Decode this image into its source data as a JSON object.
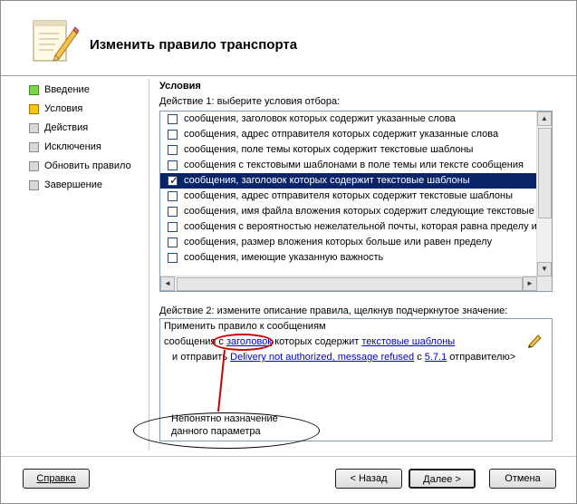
{
  "window": {
    "title": "Изменить правило транспорта"
  },
  "sidebar": {
    "items": [
      {
        "label": "Введение",
        "state": "done"
      },
      {
        "label": "Условия",
        "state": "current"
      },
      {
        "label": "Действия",
        "state": "pending"
      },
      {
        "label": "Исключения",
        "state": "pending"
      },
      {
        "label": "Обновить правило",
        "state": "pending"
      },
      {
        "label": "Завершение",
        "state": "pending"
      }
    ]
  },
  "conditions": {
    "section_title": "Условия",
    "step1_label": "Действие 1: выберите условия отбора:",
    "items": [
      {
        "label": "сообщения, заголовок которых содержит указанные слова",
        "checked": false
      },
      {
        "label": "сообщения, адрес отправителя которых содержит указанные слова",
        "checked": false
      },
      {
        "label": "сообщения, поле темы которых содержит текстовые шаблоны",
        "checked": false
      },
      {
        "label": "сообщения с текстовыми шаблонами в поле темы или тексте сообщения",
        "checked": false
      },
      {
        "label": "сообщения, заголовок которых содержит текстовые шаблоны",
        "checked": true,
        "selected": true
      },
      {
        "label": "сообщения, адрес отправителя которых содержит текстовые шаблоны",
        "checked": false
      },
      {
        "label": "сообщения, имя файла вложения которых содержит следующие текстовые",
        "checked": false
      },
      {
        "label": "сообщения с вероятностью нежелательной почты, которая равна пределу и",
        "checked": false
      },
      {
        "label": "сообщения, размер вложения которых больше или равен пределу",
        "checked": false
      },
      {
        "label": "сообщения, имеющие указанную важность",
        "checked": false
      }
    ],
    "step2_label": "Действие 2: измените описание правила, щелкнув подчеркнутое значение:",
    "description": {
      "line1": "Применить правило к сообщениям",
      "line2_prefix": "сообщения с",
      "line2_link1": "заголовок",
      "line2_mid": "которых содержит",
      "line2_link2": "текстовые шаблоны",
      "line3_prefix": "и отправить",
      "line3_link1": "Delivery not authorized, message refused",
      "line3_mid": "с",
      "line3_link2": "5.7.1",
      "line3_suffix": "отправителю>"
    }
  },
  "annotation": {
    "text_line1": "Непонятно назначение",
    "text_line2": "данного параметра",
    "color": "#cc0000"
  },
  "buttons": {
    "help": "Справка",
    "back": "< Назад",
    "next": "Далее >",
    "cancel": "Отмена"
  }
}
